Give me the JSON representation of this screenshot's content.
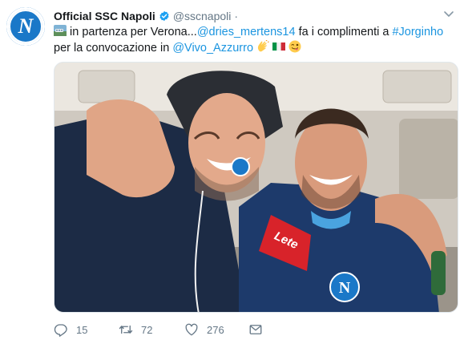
{
  "tweet": {
    "display_name": "Official SSC Napoli",
    "handle": "@sscnapoli",
    "separator": "·",
    "avatar_letter": "N",
    "verified_icon": "verified-badge-icon",
    "text": {
      "line1_part1": " in partenza per Verona...",
      "mention1": "@dries_mertens14",
      "line1_part2": " fa i complimenti a ",
      "hashtag": "#Jorginho",
      "line2_part1": "per la convocazione in ",
      "mention2": "@Vivo_Azzurro",
      "emojis": [
        "clapping-hands",
        "italy-flag",
        "winking-face-tongue"
      ]
    },
    "media": {
      "shirt_logo": "N",
      "sponsor": "Lete"
    },
    "actions": {
      "reply_count": "15",
      "retweet_count": "72",
      "like_count": "276"
    }
  },
  "colors": {
    "link": "#1b95e0",
    "muted": "#657786",
    "brand": "#1a78c8",
    "verified": "#1da1f2"
  }
}
